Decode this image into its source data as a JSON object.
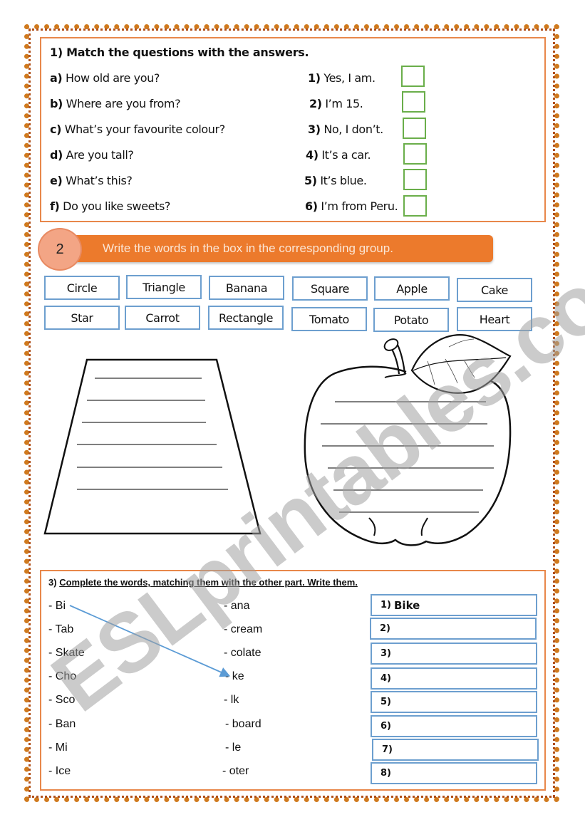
{
  "section1": {
    "title": "1) Match the questions with the answers.",
    "questions": [
      {
        "letter": "a)",
        "text": "How old are you?"
      },
      {
        "letter": "b)",
        "text": "Where are you from?"
      },
      {
        "letter": "c)",
        "text": "What’s your favourite colour?"
      },
      {
        "letter": "d)",
        "text": "Are you tall?"
      },
      {
        "letter": "e)",
        "text": "What’s this?"
      },
      {
        "letter": "f)",
        "text": "Do you like sweets?"
      }
    ],
    "answers": [
      {
        "number": "1)",
        "text": "Yes, I am."
      },
      {
        "number": "2)",
        "text": "I’m 15."
      },
      {
        "number": "3)",
        "text": "No, I don’t."
      },
      {
        "number": "4)",
        "text": "It’s a car."
      },
      {
        "number": "5)",
        "text": "It’s blue."
      },
      {
        "number": "6)",
        "text": "I’m from Peru."
      }
    ]
  },
  "section2": {
    "number": "2",
    "instruction": "Write the words in the box in the corresponding group.",
    "words_row1": [
      "Circle",
      "Triangle",
      "Banana",
      "Square",
      "Apple",
      "Cake"
    ],
    "words_row2": [
      "Star",
      "Carrot",
      "Rectangle",
      "Tomato",
      "Potato",
      "Heart"
    ],
    "groups": [
      "shapes (trapezoid)",
      "food (apple)"
    ]
  },
  "section3": {
    "title_prefix": "3)",
    "title": "Complete the words, matching them with the other part. Write them.",
    "left_fragments": [
      "- Bi",
      "- Tab",
      "- Skate",
      "- Cho",
      "- Sco",
      "- Ban",
      "- Mi",
      "- Ice"
    ],
    "right_fragments": [
      "- ana",
      "- cream",
      "- colate",
      "- ke",
      "- lk",
      "- board",
      "- le",
      "- oter"
    ],
    "answers": [
      {
        "number": "1)",
        "value": "Bike"
      },
      {
        "number": "2)",
        "value": ""
      },
      {
        "number": "3)",
        "value": ""
      },
      {
        "number": "4)",
        "value": ""
      },
      {
        "number": "5)",
        "value": ""
      },
      {
        "number": "6)",
        "value": ""
      },
      {
        "number": "7)",
        "value": ""
      },
      {
        "number": "8)",
        "value": ""
      }
    ],
    "example_arrow": {
      "from": "- Bi",
      "to": "- ke"
    }
  },
  "watermark": "ESLprintables.com",
  "colors": {
    "section_border": "#e8874a",
    "banner": "#ec7a2c",
    "circle": "#f3a585",
    "checkbox_border": "#6aae4a",
    "word_box_border": "#6d9fcf",
    "arrow": "#5b9bd5"
  }
}
